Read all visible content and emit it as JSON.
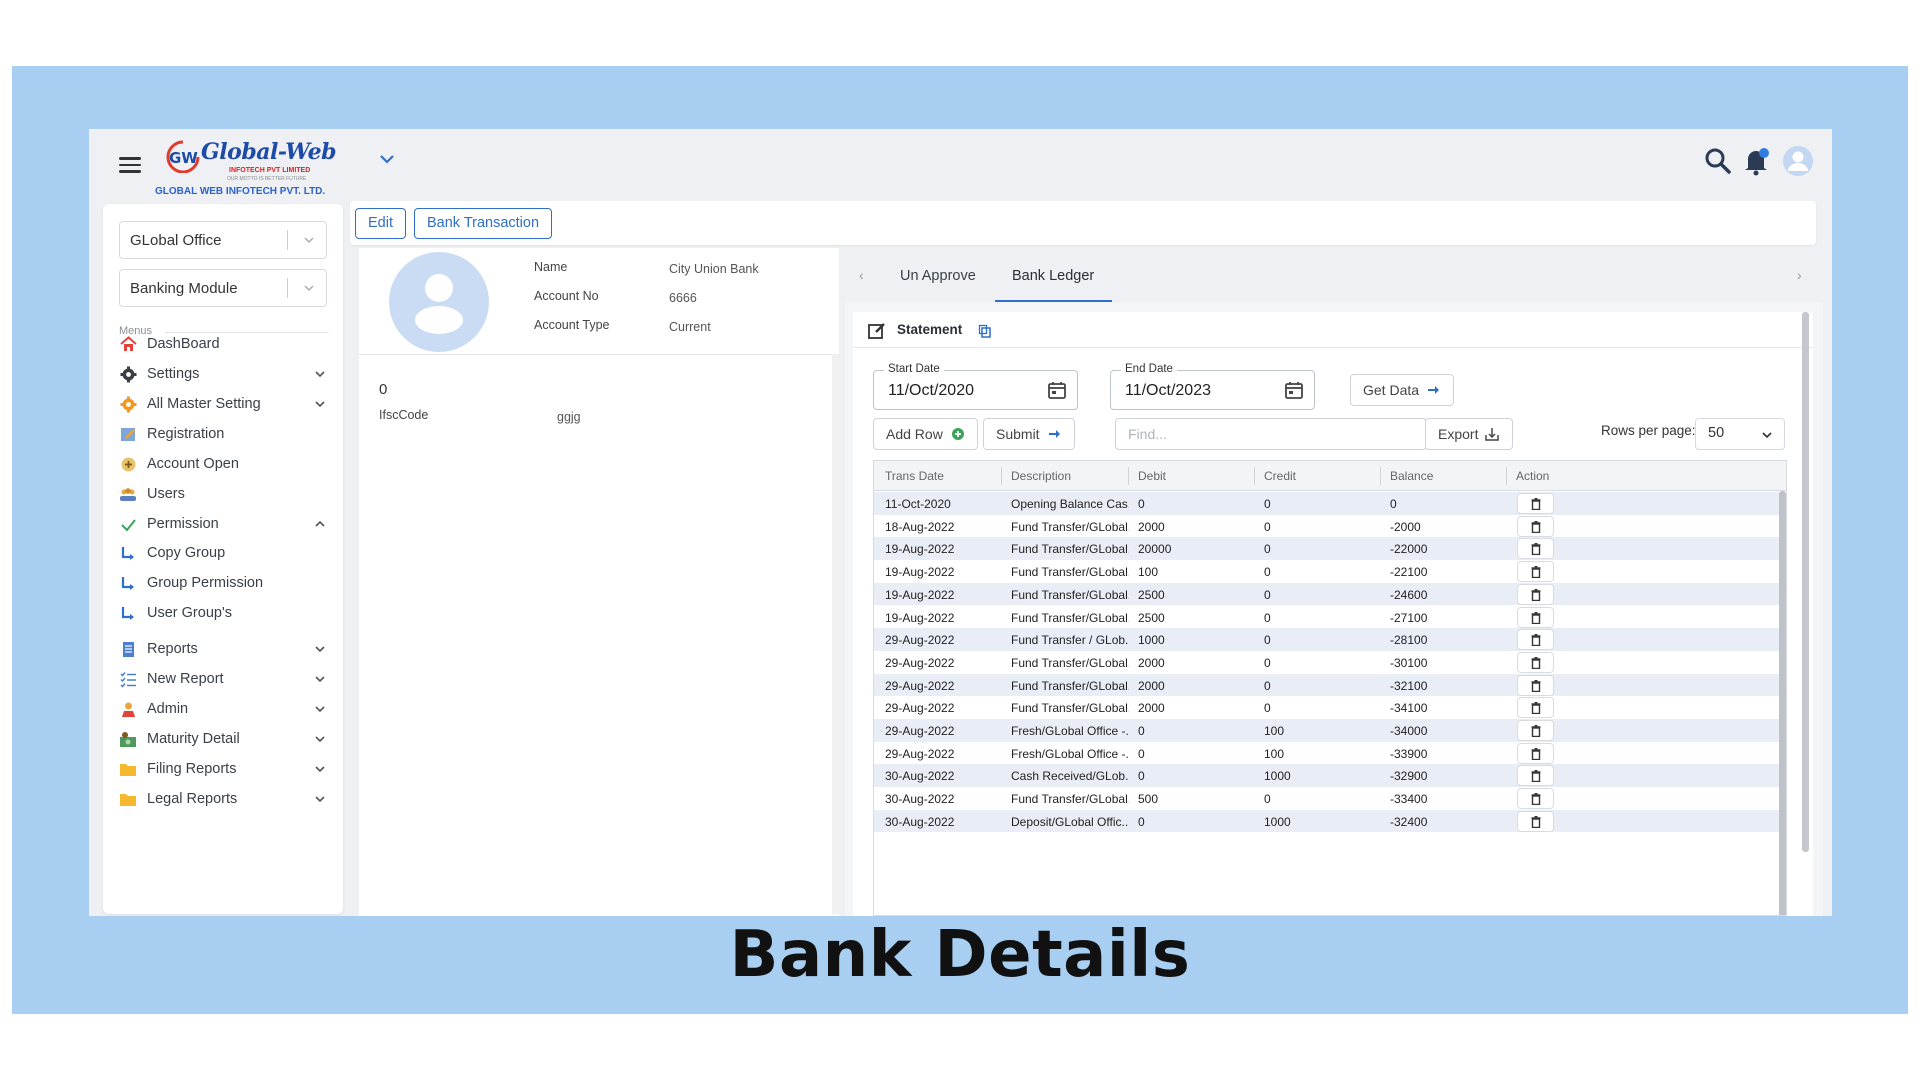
{
  "caption": "Bank Details",
  "brand": {
    "name": "Global-Web",
    "subtitle": "INFOTECH PVT LIMITED",
    "tagline": "OUR MOTTO IS BETTER FUTURE",
    "company": "GLOBAL WEB INFOTECH PVT. LTD."
  },
  "sidebar": {
    "office_select": "GLobal Office",
    "module_select": "Banking Module",
    "menus_label": "Menus",
    "items": [
      {
        "label": "DashBoard",
        "icon": "home-icon",
        "chevron": ""
      },
      {
        "label": "Settings",
        "icon": "gear-icon",
        "chevron": "down"
      },
      {
        "label": "All Master Setting",
        "icon": "cog-orange-icon",
        "chevron": "down"
      },
      {
        "label": "Registration",
        "icon": "registration-icon",
        "chevron": ""
      },
      {
        "label": "Account Open",
        "icon": "plus-circle-icon",
        "chevron": ""
      },
      {
        "label": "Users",
        "icon": "users-icon",
        "chevron": ""
      },
      {
        "label": "Permission",
        "icon": "check-icon",
        "chevron": "up"
      },
      {
        "label": "Copy Group",
        "icon": "subitem-arrow-icon",
        "chevron": ""
      },
      {
        "label": "Group Permission",
        "icon": "subitem-arrow-icon",
        "chevron": ""
      },
      {
        "label": "User Group's",
        "icon": "subitem-arrow-icon",
        "chevron": ""
      },
      {
        "label": "Reports",
        "icon": "report-icon",
        "chevron": "down"
      },
      {
        "label": "New Report",
        "icon": "list-icon",
        "chevron": "down"
      },
      {
        "label": "Admin",
        "icon": "admin-icon",
        "chevron": "down"
      },
      {
        "label": "Maturity Detail",
        "icon": "money-icon",
        "chevron": "down"
      },
      {
        "label": "Filing Reports",
        "icon": "folder-icon",
        "chevron": "down"
      },
      {
        "label": "Legal Reports",
        "icon": "folder-icon",
        "chevron": "down"
      }
    ]
  },
  "toolbar": {
    "edit_label": "Edit",
    "bank_txn_label": "Bank Transaction"
  },
  "account": {
    "name_label": "Name",
    "name_value": "City Union Bank",
    "acc_no_label": "Account No",
    "acc_no_value": "6666",
    "acc_type_label": "Account Type",
    "acc_type_value": "Current",
    "extra_value": "0",
    "ifsc_label": "IfscCode",
    "ifsc_value": "ggjg"
  },
  "tabs": {
    "unapprove": "Un Approve",
    "ledger": "Bank Ledger"
  },
  "statement": {
    "title": "Statement",
    "start_label": "Start Date",
    "start_value": "11/Oct/2020",
    "end_label": "End Date",
    "end_value": "11/Oct/2023",
    "get_data": "Get Data",
    "add_row": "Add Row",
    "submit": "Submit",
    "find_placeholder": "Find...",
    "export": "Export",
    "rows_per_page_label": "Rows per page:",
    "rows_per_page_value": "50"
  },
  "grid": {
    "headers": [
      "Trans Date",
      "Description",
      "Debit",
      "Credit",
      "Balance",
      "Action"
    ],
    "rows": [
      [
        "11-Oct-2020",
        "Opening Balance Cas...",
        "0",
        "0",
        "0"
      ],
      [
        "18-Aug-2022",
        "Fund Transfer/GLobal...",
        "2000",
        "0",
        "-2000"
      ],
      [
        "19-Aug-2022",
        "Fund Transfer/GLobal...",
        "20000",
        "0",
        "-22000"
      ],
      [
        "19-Aug-2022",
        "Fund Transfer/GLobal...",
        "100",
        "0",
        "-22100"
      ],
      [
        "19-Aug-2022",
        "Fund Transfer/GLobal...",
        "2500",
        "0",
        "-24600"
      ],
      [
        "19-Aug-2022",
        "Fund Transfer/GLobal...",
        "2500",
        "0",
        "-27100"
      ],
      [
        "29-Aug-2022",
        "Fund Transfer / GLob...",
        "1000",
        "0",
        "-28100"
      ],
      [
        "29-Aug-2022",
        "Fund Transfer/GLobal...",
        "2000",
        "0",
        "-30100"
      ],
      [
        "29-Aug-2022",
        "Fund Transfer/GLobal...",
        "2000",
        "0",
        "-32100"
      ],
      [
        "29-Aug-2022",
        "Fund Transfer/GLobal...",
        "2000",
        "0",
        "-34100"
      ],
      [
        "29-Aug-2022",
        "Fresh/GLobal Office -...",
        "0",
        "100",
        "-34000"
      ],
      [
        "29-Aug-2022",
        "Fresh/GLobal Office -...",
        "0",
        "100",
        "-33900"
      ],
      [
        "30-Aug-2022",
        "Cash Received/GLob...",
        "0",
        "1000",
        "-32900"
      ],
      [
        "30-Aug-2022",
        "Fund Transfer/GLobal...",
        "500",
        "0",
        "-33400"
      ],
      [
        "30-Aug-2022",
        "Deposit/GLobal Offic...",
        "0",
        "1000",
        "-32400"
      ]
    ]
  },
  "colors": {
    "accent": "#2f6fc9",
    "band": "#a8cff2",
    "row_alt": "#e9eef6"
  }
}
